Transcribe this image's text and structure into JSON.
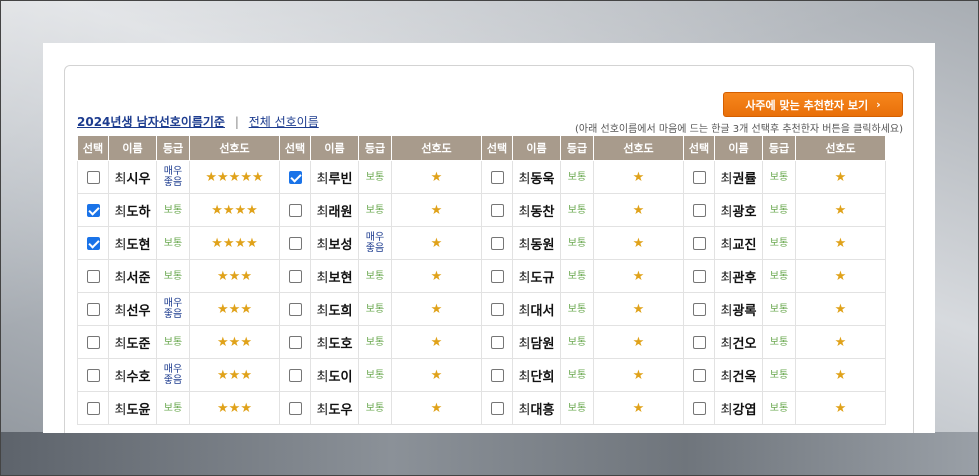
{
  "title": {
    "main_link": "2024년생 남자선호이름기준",
    "separator": "|",
    "all_link": "전체 선호이름"
  },
  "cta": {
    "label": "사주에 맞는 추천한자 보기",
    "chevron": "›"
  },
  "hint": "(아래 선호이름에서 마음에 드는 한글 3개 선택후 추천한자 버튼을 클릭하세요)",
  "columns": [
    "선택",
    "이름",
    "등급",
    "선호도"
  ],
  "colors": {
    "header_bg": "#a89b8c",
    "cta": "#f7861c",
    "star": "#e0a21a"
  },
  "rows": [
    [
      {
        "surname": "최",
        "given": "시우",
        "grade": "매우좋음",
        "stars": "★★★★★",
        "checked": false
      },
      {
        "surname": "최",
        "given": "루빈",
        "grade": "보통",
        "stars": "★",
        "checked": true
      },
      {
        "surname": "최",
        "given": "동욱",
        "grade": "보통",
        "stars": "★",
        "checked": false
      },
      {
        "surname": "최",
        "given": "권률",
        "grade": "보통",
        "stars": "★",
        "checked": false
      }
    ],
    [
      {
        "surname": "최",
        "given": "도하",
        "grade": "보통",
        "stars": "★★★★",
        "checked": true
      },
      {
        "surname": "최",
        "given": "래원",
        "grade": "보통",
        "stars": "★",
        "checked": false
      },
      {
        "surname": "최",
        "given": "동찬",
        "grade": "보통",
        "stars": "★",
        "checked": false
      },
      {
        "surname": "최",
        "given": "광호",
        "grade": "보통",
        "stars": "★",
        "checked": false
      }
    ],
    [
      {
        "surname": "최",
        "given": "도현",
        "grade": "보통",
        "stars": "★★★★",
        "checked": true
      },
      {
        "surname": "최",
        "given": "보성",
        "grade": "매우좋음",
        "stars": "★",
        "checked": false
      },
      {
        "surname": "최",
        "given": "동원",
        "grade": "보통",
        "stars": "★",
        "checked": false
      },
      {
        "surname": "최",
        "given": "교진",
        "grade": "보통",
        "stars": "★",
        "checked": false
      }
    ],
    [
      {
        "surname": "최",
        "given": "서준",
        "grade": "보통",
        "stars": "★★★",
        "checked": false
      },
      {
        "surname": "최",
        "given": "보현",
        "grade": "보통",
        "stars": "★",
        "checked": false
      },
      {
        "surname": "최",
        "given": "도규",
        "grade": "보통",
        "stars": "★",
        "checked": false
      },
      {
        "surname": "최",
        "given": "관후",
        "grade": "보통",
        "stars": "★",
        "checked": false
      }
    ],
    [
      {
        "surname": "최",
        "given": "선우",
        "grade": "매우좋음",
        "stars": "★★★",
        "checked": false
      },
      {
        "surname": "최",
        "given": "도희",
        "grade": "보통",
        "stars": "★",
        "checked": false
      },
      {
        "surname": "최",
        "given": "대서",
        "grade": "보통",
        "stars": "★",
        "checked": false
      },
      {
        "surname": "최",
        "given": "광록",
        "grade": "보통",
        "stars": "★",
        "checked": false
      }
    ],
    [
      {
        "surname": "최",
        "given": "도준",
        "grade": "보통",
        "stars": "★★★",
        "checked": false
      },
      {
        "surname": "최",
        "given": "도호",
        "grade": "보통",
        "stars": "★",
        "checked": false
      },
      {
        "surname": "최",
        "given": "담원",
        "grade": "보통",
        "stars": "★",
        "checked": false
      },
      {
        "surname": "최",
        "given": "건오",
        "grade": "보통",
        "stars": "★",
        "checked": false
      }
    ],
    [
      {
        "surname": "최",
        "given": "수호",
        "grade": "매우좋음",
        "stars": "★★★",
        "checked": false
      },
      {
        "surname": "최",
        "given": "도이",
        "grade": "보통",
        "stars": "★",
        "checked": false
      },
      {
        "surname": "최",
        "given": "단희",
        "grade": "보통",
        "stars": "★",
        "checked": false
      },
      {
        "surname": "최",
        "given": "건옥",
        "grade": "보통",
        "stars": "★",
        "checked": false
      }
    ],
    [
      {
        "surname": "최",
        "given": "도윤",
        "grade": "보통",
        "stars": "★★★",
        "checked": false
      },
      {
        "surname": "최",
        "given": "도우",
        "grade": "보통",
        "stars": "★",
        "checked": false
      },
      {
        "surname": "최",
        "given": "대흥",
        "grade": "보통",
        "stars": "★",
        "checked": false
      },
      {
        "surname": "최",
        "given": "강엽",
        "grade": "보통",
        "stars": "★",
        "checked": false
      }
    ]
  ]
}
